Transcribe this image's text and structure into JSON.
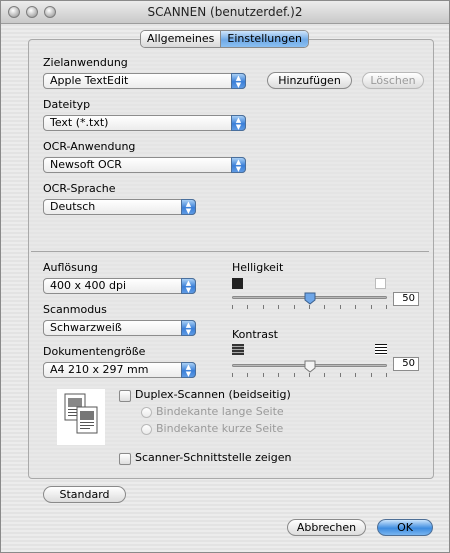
{
  "window": {
    "title": "SCANNEN (benutzerdef.)2"
  },
  "tabs": [
    {
      "label": "Allgemeines",
      "active": false
    },
    {
      "label": "Einstellungen",
      "active": true
    }
  ],
  "target_app": {
    "label": "Zielanwendung",
    "value": "Apple TextEdit",
    "add_button": "Hinzufügen",
    "delete_button": "Löschen"
  },
  "file_type": {
    "label": "Dateityp",
    "value": "Text (*.txt)"
  },
  "ocr_app": {
    "label": "OCR-Anwendung",
    "value": "Newsoft OCR"
  },
  "ocr_language": {
    "label": "OCR-Sprache",
    "value": "Deutsch"
  },
  "resolution": {
    "label": "Auflösung",
    "value": "400 x 400 dpi"
  },
  "scan_mode": {
    "label": "Scanmodus",
    "value": "Schwarzweiß"
  },
  "doc_size": {
    "label": "Dokumentengröße",
    "value": "A4  210 x 297 mm"
  },
  "brightness": {
    "label": "Helligkeit",
    "value": "50",
    "fraction": 0.5
  },
  "contrast": {
    "label": "Kontrast",
    "value": "50",
    "fraction": 0.5
  },
  "duplex": {
    "label": "Duplex-Scannen (beidseitig)",
    "checked": false,
    "long_edge": "Bindekante lange Seite",
    "short_edge": "Bindekante kurze Seite"
  },
  "show_interface": {
    "label": "Scanner-Schnittstelle zeigen",
    "checked": false
  },
  "buttons": {
    "default": "Standard",
    "cancel": "Abbrechen",
    "ok": "OK"
  },
  "colors": {
    "accent": "#3f8de0",
    "tab_active": "#6fa9e6"
  }
}
